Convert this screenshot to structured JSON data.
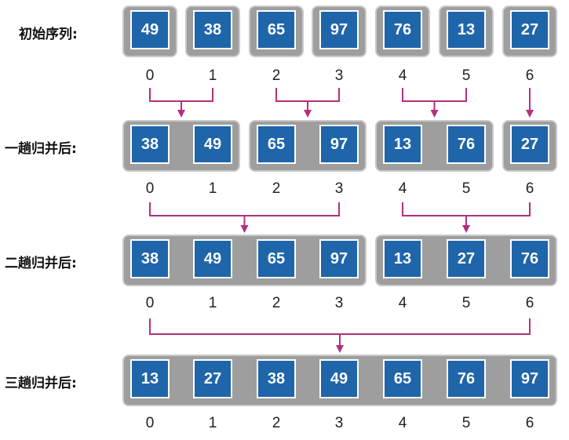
{
  "colors": {
    "cell_fill": "#1f65aa",
    "group_fill": "#9e9e9e",
    "arrow": "#b3307b",
    "text": "#111111"
  },
  "rows": [
    {
      "label": "初始序列:",
      "groups": [
        [
          49
        ],
        [
          38
        ],
        [
          65
        ],
        [
          97
        ],
        [
          76
        ],
        [
          13
        ],
        [
          27
        ]
      ],
      "indices": [
        0,
        1,
        2,
        3,
        4,
        5,
        6
      ]
    },
    {
      "label": "一趟归并后:",
      "groups": [
        [
          38,
          49
        ],
        [
          65,
          97
        ],
        [
          13,
          76
        ],
        [
          27
        ]
      ],
      "indices": [
        0,
        1,
        2,
        3,
        4,
        5,
        6
      ]
    },
    {
      "label": "二趟归并后:",
      "groups": [
        [
          38,
          49,
          65,
          97
        ],
        [
          13,
          27,
          76
        ]
      ],
      "indices": [
        0,
        1,
        2,
        3,
        4,
        5,
        6
      ]
    },
    {
      "label": "三趟归并后:",
      "groups": [
        [
          13,
          27,
          38,
          49,
          65,
          76,
          97
        ]
      ],
      "indices": [
        0,
        1,
        2,
        3,
        4,
        5,
        6
      ]
    }
  ],
  "merges": [
    [
      [
        0,
        1
      ],
      [
        2,
        3
      ],
      [
        4,
        5
      ],
      [
        6
      ]
    ],
    [
      [
        0,
        3
      ],
      [
        4,
        6
      ]
    ],
    [
      [
        0,
        6
      ]
    ]
  ]
}
